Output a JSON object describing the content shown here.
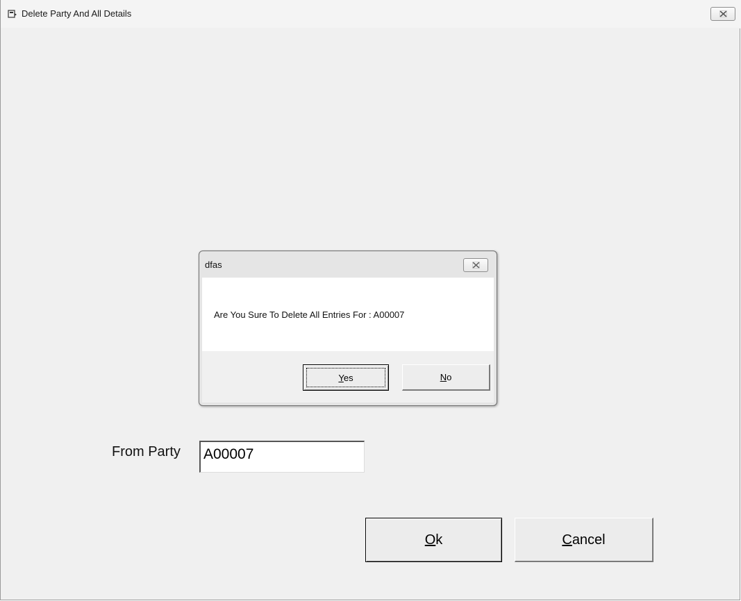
{
  "window": {
    "title": "Delete Party And All Details",
    "app_icon": "window-app-icon",
    "close_icon": "close-icon"
  },
  "form": {
    "from_party_label": "From Party",
    "from_party_value": "A00007",
    "ok_mnemonic": "O",
    "ok_rest": "k",
    "cancel_mnemonic": "C",
    "cancel_rest": "ancel"
  },
  "dialog": {
    "title": "dfas",
    "message": "Are You Sure To Delete All Entries For : A00007",
    "yes_mnemonic": "Y",
    "yes_rest": "es",
    "no_mnemonic": "N",
    "no_rest": "o",
    "close_icon": "close-icon"
  }
}
